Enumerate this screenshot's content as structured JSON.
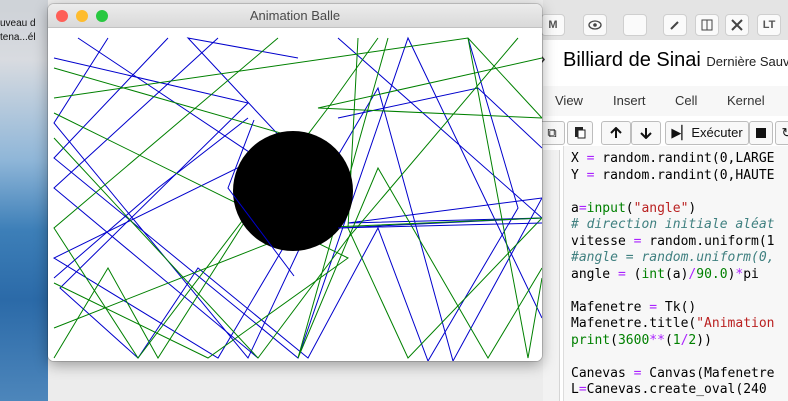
{
  "desktop": {
    "labels": [
      "uveau d",
      "tena...él"
    ]
  },
  "browser": {
    "tab_icons": [
      "M",
      "",
      "",
      "",
      "",
      "",
      "LT"
    ],
    "notebook_title": "Billiard de Sinai",
    "save_status": "Dernière Sauve",
    "menu": [
      "View",
      "Insert",
      "Cell",
      "Kernel"
    ],
    "run_label": "Exécuter",
    "code_lines": [
      {
        "parts": [
          [
            "",
            "X "
          ],
          [
            "kw-purple",
            "="
          ],
          [
            "",
            " random.randint(0,LARGE"
          ]
        ]
      },
      {
        "parts": [
          [
            "",
            "Y "
          ],
          [
            "kw-purple",
            "="
          ],
          [
            "",
            " random.randint(0,HAUTE"
          ]
        ]
      },
      {
        "parts": [
          [
            "",
            ""
          ]
        ]
      },
      {
        "parts": [
          [
            "",
            "a"
          ],
          [
            "kw-purple",
            "="
          ],
          [
            "kw-green",
            "input"
          ],
          [
            "",
            "("
          ],
          [
            "str-red",
            "\"angle\""
          ],
          [
            "",
            ")"
          ]
        ]
      },
      {
        "parts": [
          [
            "cmt",
            "# direction initiale aléat"
          ]
        ]
      },
      {
        "parts": [
          [
            "",
            "vitesse "
          ],
          [
            "kw-purple",
            "="
          ],
          [
            "",
            " random.uniform(1"
          ]
        ]
      },
      {
        "parts": [
          [
            "cmt",
            "#angle = random.uniform(0,"
          ]
        ]
      },
      {
        "parts": [
          [
            "",
            "angle "
          ],
          [
            "kw-purple",
            "="
          ],
          [
            "",
            " ("
          ],
          [
            "kw-green",
            "int"
          ],
          [
            "",
            "(a)"
          ],
          [
            "kw-purple",
            "/"
          ],
          [
            "num-green",
            "90.0"
          ],
          [
            "",
            ")"
          ],
          [
            "kw-purple",
            "*"
          ],
          [
            "",
            "pi"
          ]
        ]
      },
      {
        "parts": [
          [
            "",
            ""
          ]
        ]
      },
      {
        "parts": [
          [
            "",
            "Mafenetre "
          ],
          [
            "kw-purple",
            "="
          ],
          [
            "",
            " Tk()"
          ]
        ]
      },
      {
        "parts": [
          [
            "",
            "Mafenetre.title("
          ],
          [
            "str-red",
            "\"Animation"
          ]
        ]
      },
      {
        "parts": [
          [
            "kw-green",
            "print"
          ],
          [
            "",
            "("
          ],
          [
            "num-green",
            "3600"
          ],
          [
            "kw-purple",
            "**"
          ],
          [
            "",
            "("
          ],
          [
            "num-green",
            "1"
          ],
          [
            "kw-purple",
            "/"
          ],
          [
            "num-green",
            "2"
          ],
          [
            "",
            "))"
          ]
        ]
      },
      {
        "parts": [
          [
            "",
            ""
          ]
        ]
      },
      {
        "parts": [
          [
            "",
            "Canevas "
          ],
          [
            "kw-purple",
            "="
          ],
          [
            "",
            " Canvas(Mafenetre"
          ]
        ]
      },
      {
        "parts": [
          [
            "",
            "L"
          ],
          [
            "kw-purple",
            "="
          ],
          [
            "",
            "Canevas.create_oval(240"
          ]
        ]
      }
    ]
  },
  "window": {
    "title": "Animation Balle",
    "close_color": "#fe5f57",
    "minimize_color": "#febc2e",
    "zoom_color": "#28c840"
  },
  "canvas": {
    "background": "#ffffff",
    "obstacle_color": "#000000",
    "trail_colors": [
      "#0000cc",
      "#008000"
    ]
  }
}
